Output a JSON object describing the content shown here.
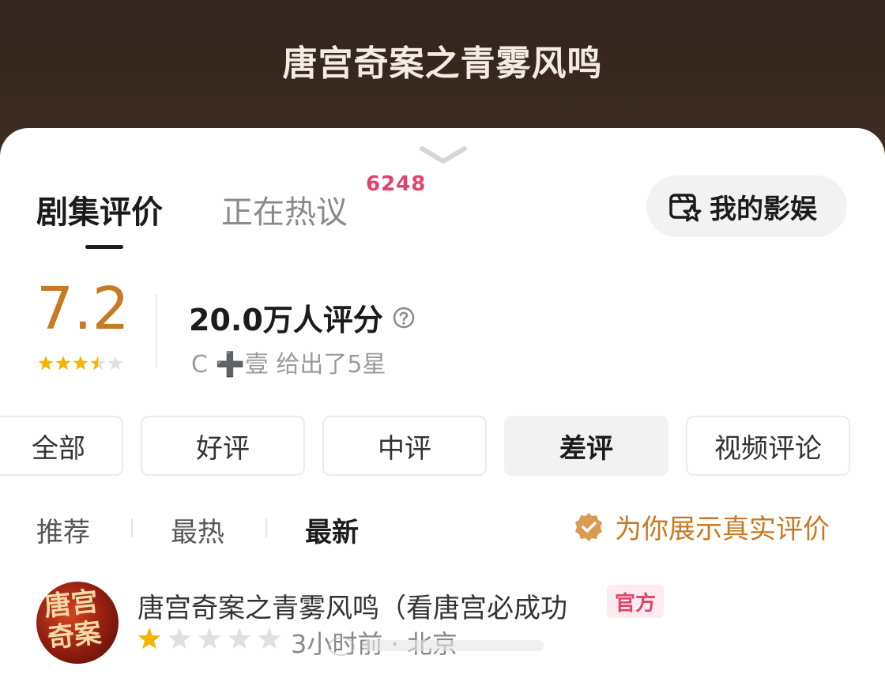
{
  "header": {
    "title": "唐宫奇案之青雾风鸣"
  },
  "tabs": [
    {
      "label": "剧集评价",
      "active": true
    },
    {
      "label": "正在热议",
      "badge": "6248"
    }
  ],
  "my_entertainment_button": {
    "label": "我的影娱",
    "icon": "film-star-icon"
  },
  "rating": {
    "score": "7.2",
    "stars": 3.5,
    "raters_text": "20.0万人评分",
    "user_line": "C ➕壹 给出了5星"
  },
  "filters": [
    "全部",
    "好评",
    "中评",
    "差评",
    "视频评论"
  ],
  "active_filter": "差评",
  "sort": {
    "options": [
      "推荐",
      "最热",
      "最新"
    ],
    "active": "最新"
  },
  "real_review_text": "为你展示真实评价",
  "comment": {
    "author": "唐宫奇案之青雾风鸣（看唐宫必成功",
    "badge": "官方",
    "stars": 1,
    "meta": "3小时前 · 北京",
    "avatar_text": "唐宫奇案"
  },
  "colors": {
    "header_bg": "#3a2a20",
    "score": "#c67a23",
    "accent_pink": "#e0436b",
    "star_gold": "#f5b400",
    "star_gray": "#e0e0e0"
  }
}
